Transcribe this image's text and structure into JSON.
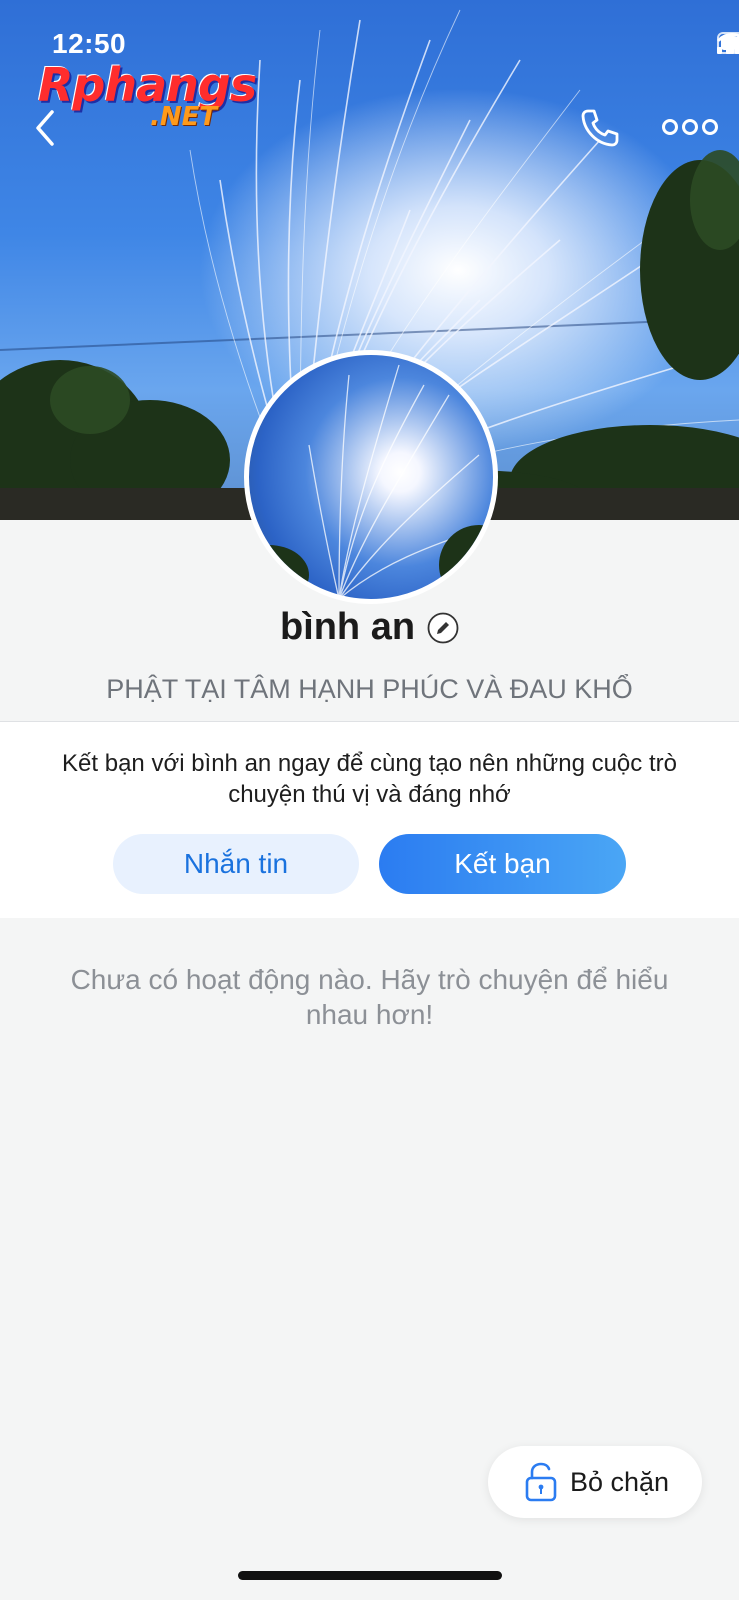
{
  "status_bar": {
    "time": "12:50"
  },
  "watermark": {
    "main": "Rphangs",
    "sub": ".NET"
  },
  "header": {
    "back_icon": "chevron-left-icon",
    "call_icon": "phone-icon",
    "more_icon": "more-dots-icon"
  },
  "profile": {
    "name": "bình an",
    "status": "PHẬT TẠI TÂM HẠNH PHÚC VÀ ĐAU KHỔ"
  },
  "friend_prompt": {
    "text": "Kết bạn với bình an ngay để cùng tạo nên những cuộc trò chuyện thú vị và đáng nhớ",
    "message_label": "Nhắn tin",
    "add_friend_label": "Kết bạn"
  },
  "activity": {
    "empty_text": "Chưa có hoạt động nào. Hãy trò chuyện để hiểu nhau hơn!"
  },
  "unblock": {
    "label": "Bỏ chặn"
  },
  "colors": {
    "accent": "#2b7cf1",
    "accent_light": "#e8f1fe",
    "background": "#f4f5f5"
  }
}
